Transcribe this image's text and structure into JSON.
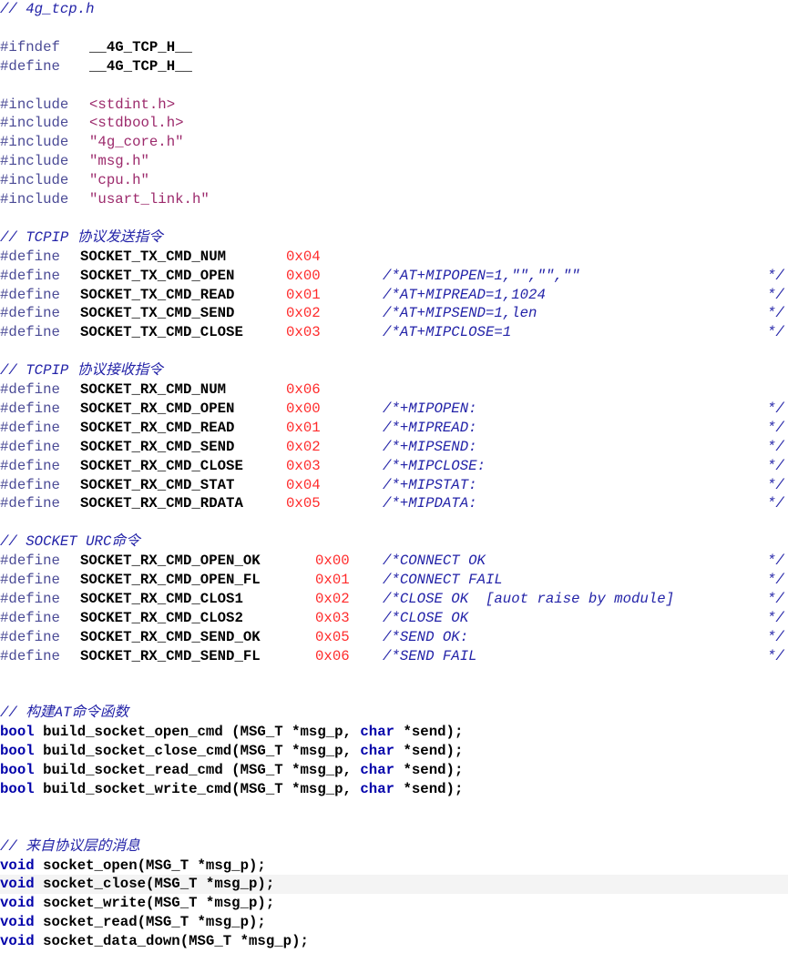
{
  "colors": {
    "comment": "#2323a8",
    "preprocessor": "#4b4b96",
    "string": "#9c2a6c",
    "identifier": "#000000",
    "number": "#ff2b2b",
    "keyword": "#0000aa",
    "current_line_background": "#f4f4f4",
    "editor_background": "#ffffff"
  },
  "editor": {
    "lines": [
      {
        "text": "// 4g_tcp.h"
      },
      {
        "text": ""
      },
      {
        "text": "#ifndef   __4G_TCP_H__"
      },
      {
        "text": "#define   __4G_TCP_H__"
      },
      {
        "text": ""
      },
      {
        "text": "#include <stdint.h>"
      },
      {
        "text": "#include <stdbool.h>"
      },
      {
        "text": "#include \"4g_core.h\""
      },
      {
        "text": "#include \"msg.h\""
      },
      {
        "text": "#include \"cpu.h\""
      },
      {
        "text": "#include \"usart_link.h\""
      },
      {
        "text": ""
      },
      {
        "text": "// TCPIP 协议发送指令"
      },
      {
        "text": "#define SOCKET_TX_CMD_NUM    0x04"
      },
      {
        "text": "#define SOCKET_TX_CMD_OPEN   0x00    /*AT+MIPOPEN=1,\"\",\"\",\"\"  */"
      },
      {
        "text": "#define SOCKET_TX_CMD_READ   0x01    /*AT+MIPREAD=1,1024  */"
      },
      {
        "text": "#define SOCKET_TX_CMD_SEND   0x02    /*AT+MIPSEND=1,len  */"
      },
      {
        "text": "#define SOCKET_TX_CMD_CLOSE  0x03    /*AT+MIPCLOSE=1  */"
      },
      {
        "text": ""
      },
      {
        "text": "// TCPIP 协议接收指令"
      },
      {
        "text": "#define SOCKET_RX_CMD_NUM    0x06"
      },
      {
        "text": "#define SOCKET_RX_CMD_OPEN   0x00    /*+MIPOPEN:  */"
      },
      {
        "text": "#define SOCKET_RX_CMD_READ   0x01    /*+MIPREAD:  */"
      },
      {
        "text": "#define SOCKET_RX_CMD_SEND   0x02    /*+MIPSEND:  */"
      },
      {
        "text": "#define SOCKET_RX_CMD_CLOSE  0x03    /*+MIPCLOSE:  */"
      },
      {
        "text": "#define SOCKET_RX_CMD_STAT   0x04    /*+MIPSTAT:  */"
      },
      {
        "text": "#define SOCKET_RX_CMD_RDATA  0x05    /*+MIPDATA:  */"
      },
      {
        "text": ""
      },
      {
        "text": "// SOCKET URC命令"
      },
      {
        "text": "#define SOCKET_RX_CMD_OPEN_OK    0x00   /*CONNECT OK  */"
      },
      {
        "text": "#define SOCKET_RX_CMD_OPEN_FL    0x01   /*CONNECT FAIL  */"
      },
      {
        "text": "#define SOCKET_RX_CMD_CLOS1      0x02   /*CLOSE OK  [auot raise by module]  */"
      },
      {
        "text": "#define SOCKET_RX_CMD_CLOS2      0x03   /*CLOSE OK  */"
      },
      {
        "text": "#define SOCKET_RX_CMD_SEND_OK    0x05   /*SEND OK:  */"
      },
      {
        "text": "#define SOCKET_RX_CMD_SEND_FL    0x06   /*SEND FAIL  */"
      },
      {
        "text": ""
      },
      {
        "text": ""
      },
      {
        "text": "// 构建AT命令函数"
      },
      {
        "text": "bool build_socket_open_cmd (MSG_T *msg_p, char *send);"
      },
      {
        "text": "bool build_socket_close_cmd(MSG_T *msg_p, char *send);"
      },
      {
        "text": "bool build_socket_read_cmd (MSG_T *msg_p, char *send);"
      },
      {
        "text": "bool build_socket_write_cmd(MSG_T *msg_p, char *send);"
      },
      {
        "text": ""
      },
      {
        "text": ""
      },
      {
        "text": "// 来自协议层的消息"
      },
      {
        "text": "void socket_open(MSG_T *msg_p);"
      },
      {
        "text": "void socket_close(MSG_T *msg_p);"
      },
      {
        "text": "void socket_write(MSG_T *msg_p);"
      },
      {
        "text": "void socket_read(MSG_T *msg_p);"
      },
      {
        "text": "void socket_data_down(MSG_T *msg_p);"
      }
    ]
  }
}
